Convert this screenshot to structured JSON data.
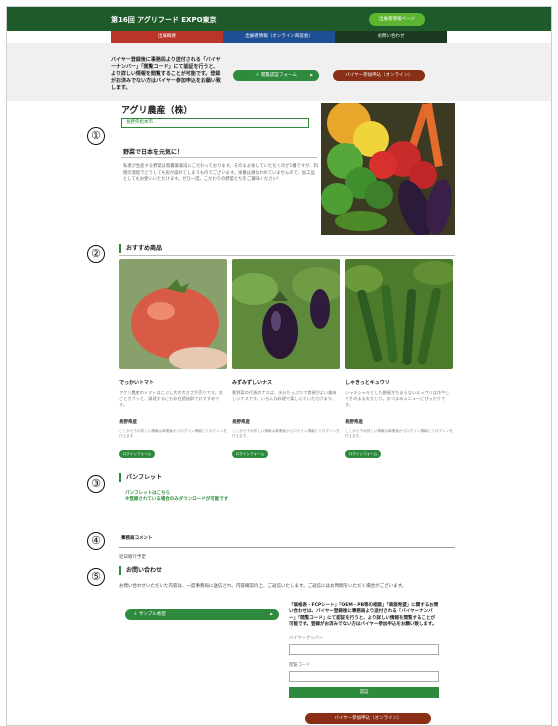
{
  "header": {
    "title": "第16回 アグリフード EXPO東京",
    "exhibitor_button": "出展者情報ページ"
  },
  "nav": {
    "items": [
      "出展概要",
      "出展者情報（オンライン商談会）",
      "お問い合わせ"
    ]
  },
  "band": {
    "note": "バイヤー登録後に事務局より送付される「バイヤーナンバー」「閲覧コード」にて認証を行うと、より詳しい情報を閲覧することが可能です。登録がお済みでない方はバイヤー参加申込をお願い致します。",
    "auth_button": "閲覧認証フォーム",
    "buyer_button": "バイヤー参加申込（オンライン）"
  },
  "markers": [
    "①",
    "②",
    "③",
    "④",
    "⑤"
  ],
  "company": {
    "name": "アグリ農産（株）",
    "location": "長野県松本市",
    "slogan": "野菜で日本を元気に！",
    "description": "私達が生産する野菜は無農薬栽培にこだわっております。そのまま食していただくのが1番ですが、料理の過程でどうしても形が崩れてしまうものでございます。栄養は損なわれていませんので、加工品としてもお使いいただけます。ぜひ一度、こだわりの野菜たちをご賞味ください！"
  },
  "recommend": {
    "heading": "おすすめ商品",
    "products": [
      {
        "name": "でっかいトマト",
        "desc": "アグリ農産のトマトはこぶし大の大きさが売りです。丸ごとカブッと、調理するにも存在感抜群でおすすめです。",
        "pref": "長野県産",
        "note": "ここから下の詳しい情報は事業者からログイン情報にてログインを行えます。",
        "button": "ログインフォーム"
      },
      {
        "name": "みずみずしいナス",
        "desc": "夏野菜の代表のナスは、水分たっぷりで食感がよい美味しいナスです。いろんな料理で楽しんでいただけます。",
        "pref": "長野県産",
        "note": "ここから下の詳しい情報は事業者からログイン情報にてログインを行えます。",
        "button": "ログインフォーム"
      },
      {
        "name": "しゃきっとキュウリ",
        "desc": "シャキシャキとした触感がたまらないキュウリは冷やしてそのまま丸かじり。おつまみメニューにぴったりです。",
        "pref": "長野県産",
        "note": "ここから下の詳しい情報は事業者からログイン情報にてログインを行えます。",
        "button": "ログインフォーム"
      }
    ]
  },
  "pamphlet": {
    "heading": "パンフレット",
    "link": "パンフレットはこちら",
    "note": "※登録されている場合のみダウンロードが可能です"
  },
  "comment": {
    "heading": "事務局コメント",
    "body": "近日紹介予定"
  },
  "contact": {
    "heading": "お問い合わせ",
    "body": "お問い合わせいただいた内容は、一度事務局に送信され、内容確認の上、ご返信いたします。ご返信にはお時間をいただく場合がございます。",
    "sample_button": "サンプル希望",
    "lead": "「価格表・FCPシート」「OEM・PB等の相談」「商談希望」に関するお問い合わせは、バイヤー登録後に事務局より送付される「バイヤーナンバー」「閲覧コード」にて認証を行うと、より詳しい情報を閲覧することが可能です。登録がお済みでない方はバイヤー参加申込をお願い致します。",
    "buyer_label": "バイヤーナンバー",
    "code_label": "閲覧コード",
    "submit": "認証",
    "buyer_button": "バイヤー参加申込（オンライン）"
  },
  "colors": {
    "brand_green": "#2e8b3e",
    "dark_green": "#1f5a2a",
    "brown": "#8a2e15"
  }
}
